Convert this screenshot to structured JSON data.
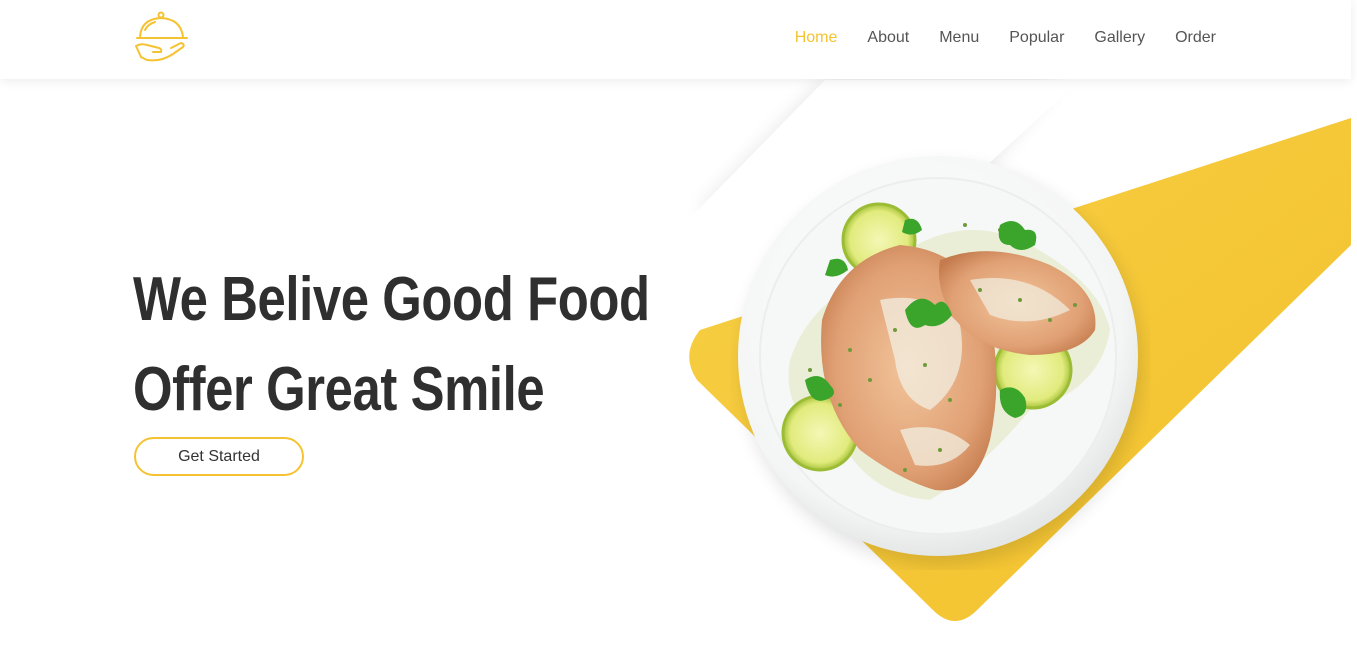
{
  "header": {
    "logo_icon": "serving-cloche-icon",
    "nav": [
      {
        "label": "Home",
        "active": true
      },
      {
        "label": "About",
        "active": false
      },
      {
        "label": "Menu",
        "active": false
      },
      {
        "label": "Popular",
        "active": false
      },
      {
        "label": "Gallery",
        "active": false
      },
      {
        "label": "Order",
        "active": false
      }
    ]
  },
  "hero": {
    "title_line_1": "We Belive Good Food",
    "title_line_2": "Offer Great Smile",
    "cta_label": "Get Started",
    "image": "grilled-chicken-plate-image"
  },
  "colors": {
    "accent": "#f5c332",
    "text_dark": "#2f2f2f",
    "nav_text": "#555555"
  }
}
